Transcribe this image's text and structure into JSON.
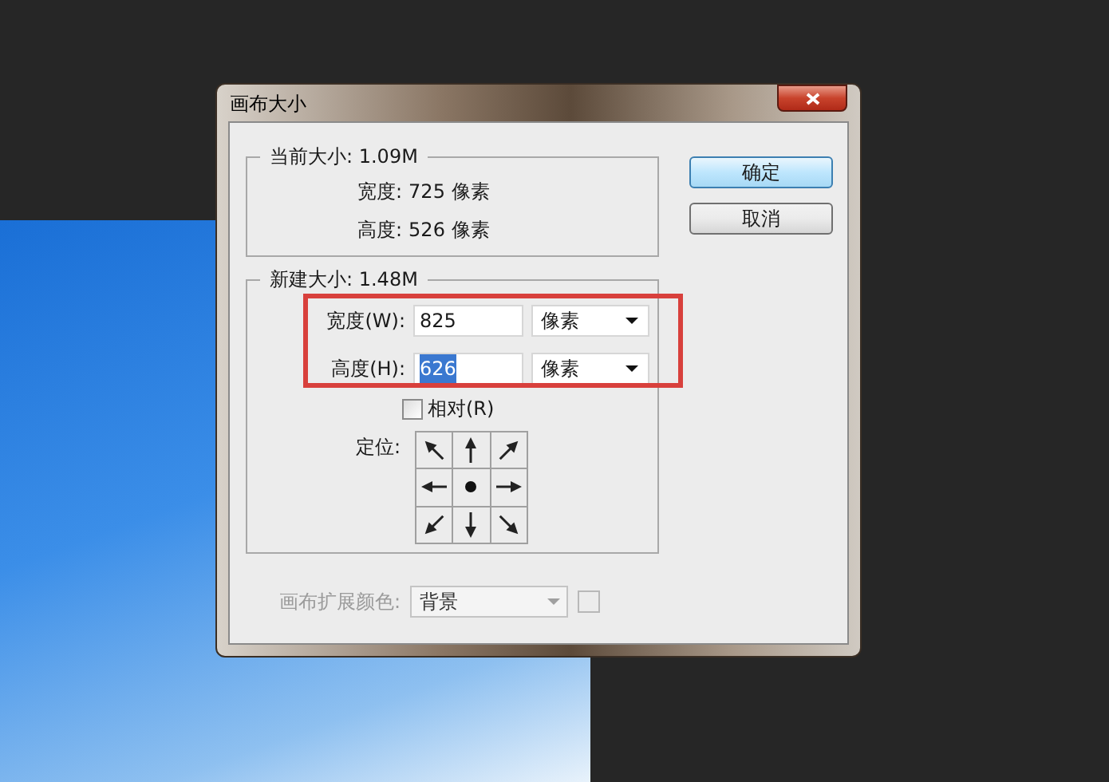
{
  "dialog": {
    "title": "画布大小",
    "current_size": {
      "legend": "当前大小: 1.09M",
      "rows": [
        {
          "label": "宽度:",
          "value": "725 像素"
        },
        {
          "label": "高度:",
          "value": "526 像素"
        }
      ]
    },
    "new_size": {
      "legend": "新建大小: 1.48M",
      "fields": [
        {
          "label": "宽度(W):",
          "value": "825",
          "unit": "像素",
          "highlighted": false
        },
        {
          "label": "高度(H):",
          "value": "626",
          "unit": "像素",
          "highlighted": true
        }
      ],
      "relative": {
        "label": "相对(R)",
        "checked": false
      },
      "anchor": {
        "label": "定位:",
        "cells": [
          {
            "selected": false
          },
          {
            "selected": false
          },
          {
            "selected": false
          },
          {
            "selected": false
          },
          {
            "selected": true
          },
          {
            "selected": false
          },
          {
            "selected": false
          },
          {
            "selected": false
          },
          {
            "selected": false
          }
        ]
      }
    },
    "extension_color": {
      "label": "画布扩展颜色:",
      "value": "背景",
      "disabled": true
    },
    "buttons": [
      {
        "label": "确定",
        "default": true
      },
      {
        "label": "取消",
        "default": false
      }
    ]
  }
}
